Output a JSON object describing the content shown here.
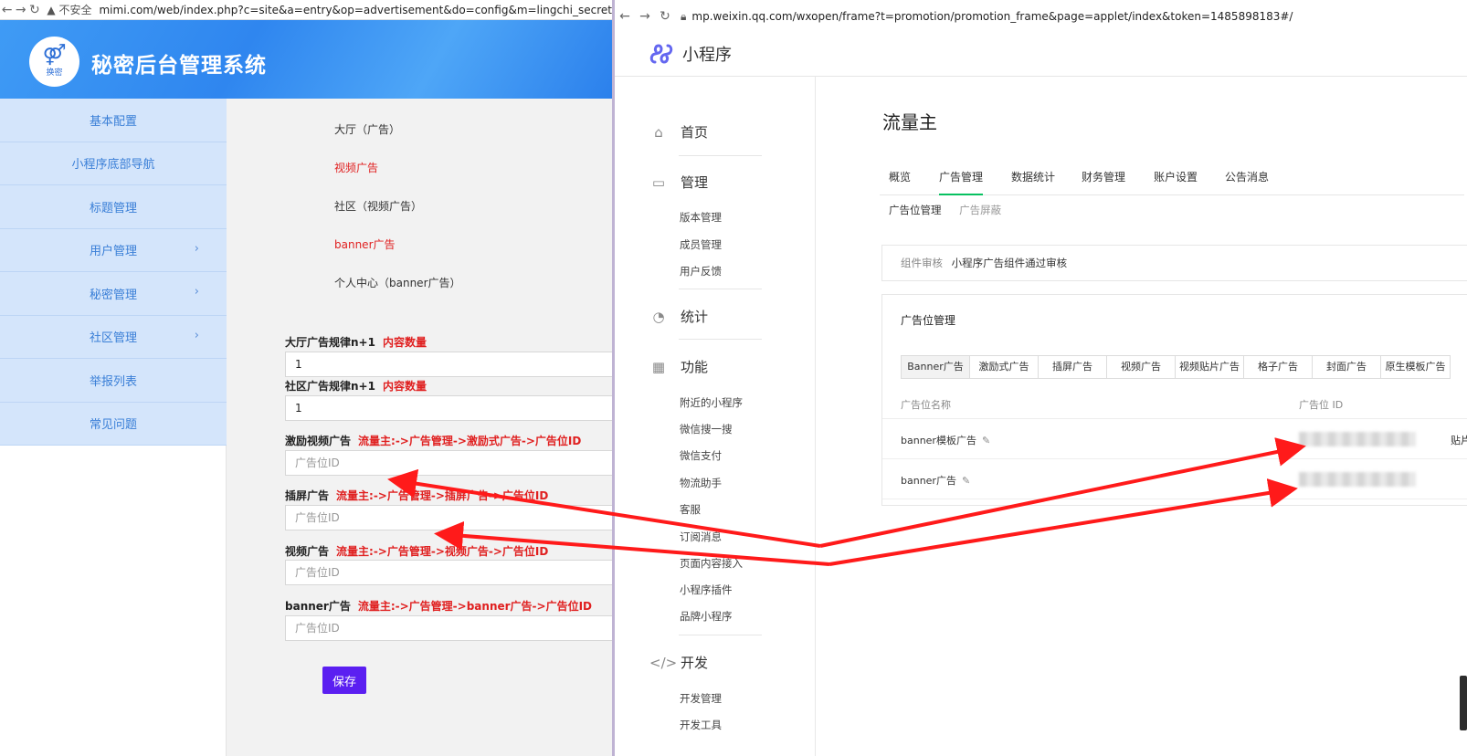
{
  "left_browser": {
    "security_label": "不安全",
    "url": "mimi.com/web/index.php?c=site&a=entry&op=advertisement&do=config&m=lingchi_secret"
  },
  "admin": {
    "logo_symbol": "⚤",
    "logo_text": "换密",
    "title": "秘密后台管理系统",
    "sidebar": [
      {
        "label": "基本配置",
        "chevron": false
      },
      {
        "label": "小程序底部导航",
        "chevron": false
      },
      {
        "label": "标题管理",
        "chevron": false
      },
      {
        "label": "用户管理",
        "chevron": true
      },
      {
        "label": "秘密管理",
        "chevron": true
      },
      {
        "label": "社区管理",
        "chevron": true
      },
      {
        "label": "举报列表",
        "chevron": false
      },
      {
        "label": "常见问题",
        "chevron": false
      }
    ],
    "ad_slots": [
      {
        "label": "大厅（广告）",
        "red": false
      },
      {
        "label": "视频广告",
        "red": true
      },
      {
        "label": "社区（视频广告）",
        "red": false
      },
      {
        "label": "banner广告",
        "red": true
      },
      {
        "label": "个人中心（banner广告）",
        "red": false
      }
    ],
    "form": [
      {
        "label": "大厅广告规律n+1",
        "hint": "内容数量",
        "value": "1",
        "placeholder": ""
      },
      {
        "label": "社区广告规律n+1",
        "hint": "内容数量",
        "value": "1",
        "placeholder": ""
      },
      {
        "label": "激励视频广告",
        "hint": "流量主:->广告管理->激励式广告->广告位ID",
        "value": "",
        "placeholder": "广告位ID"
      },
      {
        "label": "插屏广告",
        "hint": "流量主:->广告管理->插屏广告->广告位ID",
        "value": "",
        "placeholder": "广告位ID"
      },
      {
        "label": "视频广告",
        "hint": "流量主:->广告管理->视频广告->广告位ID",
        "value": "",
        "placeholder": "广告位ID"
      },
      {
        "label": "banner广告",
        "hint": "流量主:->广告管理->banner广告->广告位ID",
        "value": "",
        "placeholder": "广告位ID"
      }
    ],
    "save_label": "保存"
  },
  "right_browser": {
    "url": "mp.weixin.qq.com/wxopen/frame?t=promotion/promotion_frame&page=applet/index&token=1485898183#/"
  },
  "mp": {
    "title": "小程序",
    "nav": {
      "home": "首页",
      "manage": "管理",
      "manage_items": [
        "版本管理",
        "成员管理",
        "用户反馈"
      ],
      "stats": "统计",
      "features": "功能",
      "feature_items": [
        "附近的小程序",
        "微信搜一搜",
        "微信支付",
        "物流助手",
        "客服",
        "订阅消息",
        "页面内容接入",
        "小程序插件",
        "品牌小程序"
      ],
      "dev": "开发",
      "dev_items": [
        "开发管理",
        "开发工具"
      ]
    },
    "page_title": "流量主",
    "tabs": [
      "概览",
      "广告管理",
      "数据统计",
      "财务管理",
      "账户设置",
      "公告消息"
    ],
    "active_tab": "广告管理",
    "subtabs": [
      "广告位管理",
      "广告屏蔽"
    ],
    "audit": {
      "key": "组件审核",
      "value": "小程序广告组件通过审核"
    },
    "ad_card_title": "广告位管理",
    "ad_types": [
      "Banner广告",
      "激励式广告",
      "插屏广告",
      "视频广告",
      "视频贴片广告",
      "格子广告",
      "封面广告",
      "原生模板广告"
    ],
    "table_headers": {
      "name": "广告位名称",
      "id": "广告位 ID"
    },
    "rows": [
      {
        "name": "banner模板广告"
      },
      {
        "name": "banner广告"
      }
    ],
    "edge_text": "贴片"
  }
}
